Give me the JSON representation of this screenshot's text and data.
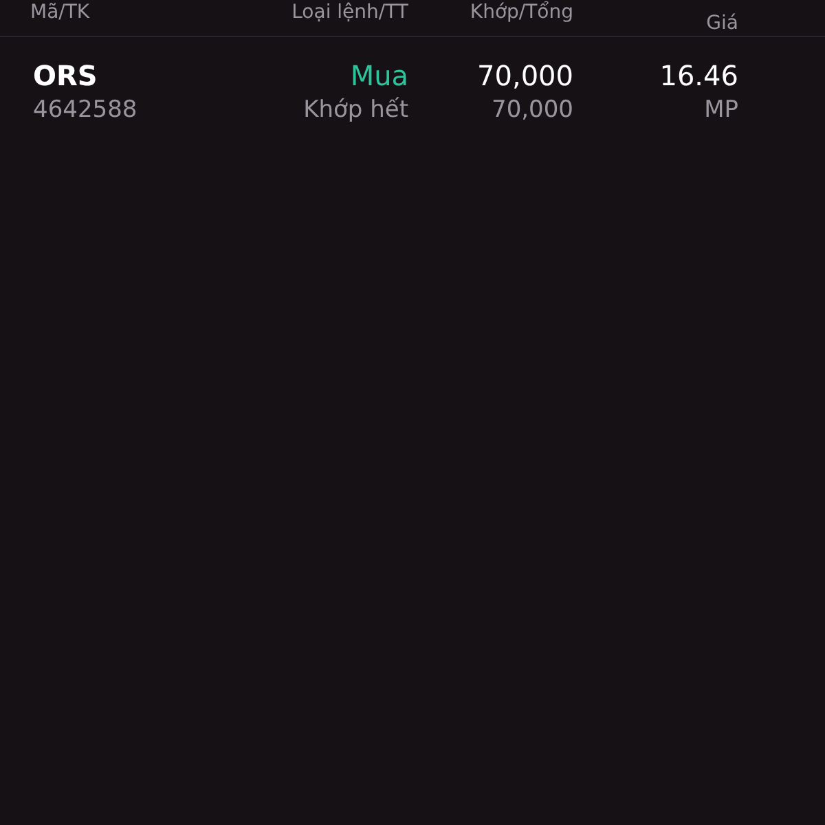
{
  "table": {
    "columns": [
      {
        "label": "Mã/TK"
      },
      {
        "label": "Loại lệnh/TT"
      },
      {
        "label": "Khớp/Tổng"
      },
      {
        "label": "Giá"
      }
    ],
    "rows": [
      {
        "symbol": "ORS",
        "account": "4642588",
        "side": {
          "text": "Mua",
          "kind": "buy"
        },
        "status": "Khớp hết",
        "matched": "70,000",
        "total": "70,000",
        "price": "16.46",
        "price_type": "MP"
      }
    ]
  }
}
